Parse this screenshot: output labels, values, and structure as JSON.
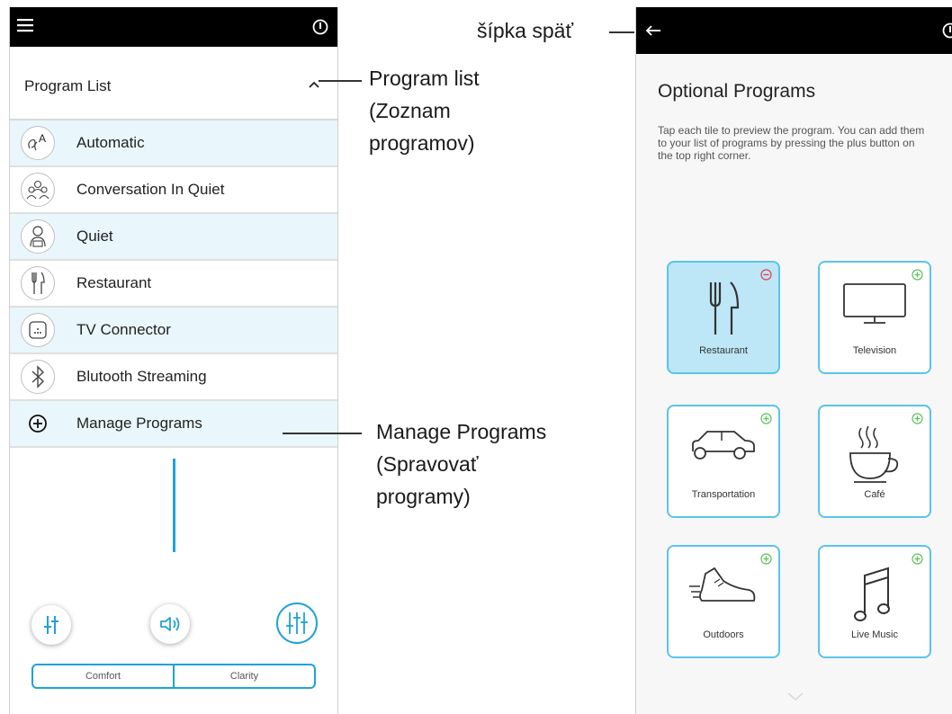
{
  "left_phone": {
    "program_list_title": "Program List",
    "programs": [
      {
        "label": "Automatic",
        "icon": "automatic-icon",
        "shaded": true
      },
      {
        "label": "Conversation In Quiet",
        "icon": "conversation-icon",
        "shaded": false
      },
      {
        "label": "Quiet",
        "icon": "quiet-person-icon",
        "shaded": true
      },
      {
        "label": "Restaurant",
        "icon": "fork-knife-icon",
        "shaded": false
      },
      {
        "label": "TV Connector",
        "icon": "tv-connector-icon",
        "shaded": true
      },
      {
        "label": "Blutooth Streaming",
        "icon": "bluetooth-icon",
        "shaded": false
      },
      {
        "label": "Manage Programs",
        "icon": "plus-circle-icon",
        "shaded": true
      }
    ],
    "modes": {
      "comfort": "Comfort",
      "clarity": "Clarity"
    }
  },
  "annotations": {
    "program_list": [
      "Program list",
      "(Zoznam",
      "programov)"
    ],
    "manage_programs": [
      "Manage Programs",
      "(Spravovať",
      "programy)"
    ],
    "back_arrow": "šípka späť"
  },
  "right_phone": {
    "title": "Optional Programs",
    "description": "Tap each tile to preview the program. You can add them to your list of programs by pressing the plus button on the top right corner.",
    "tiles": [
      {
        "label": "Restaurant",
        "icon": "fork-knife-icon",
        "badge": "minus",
        "selected": true
      },
      {
        "label": "Television",
        "icon": "television-icon",
        "badge": "plus",
        "selected": false
      },
      {
        "label": "Transportation",
        "icon": "car-icon",
        "badge": "plus",
        "selected": false
      },
      {
        "label": "Café",
        "icon": "coffee-cup-icon",
        "badge": "plus",
        "selected": false
      },
      {
        "label": "Outdoors",
        "icon": "running-shoe-icon",
        "badge": "plus",
        "selected": false
      },
      {
        "label": "Live Music",
        "icon": "music-note-icon",
        "badge": "plus",
        "selected": false
      }
    ]
  },
  "colors": {
    "accent": "#1fa2d9",
    "tile_border": "#5bc4e8",
    "minus_badge": "#e04050",
    "plus_badge": "#5cc25c",
    "row_shade": "#e9f6fb"
  }
}
